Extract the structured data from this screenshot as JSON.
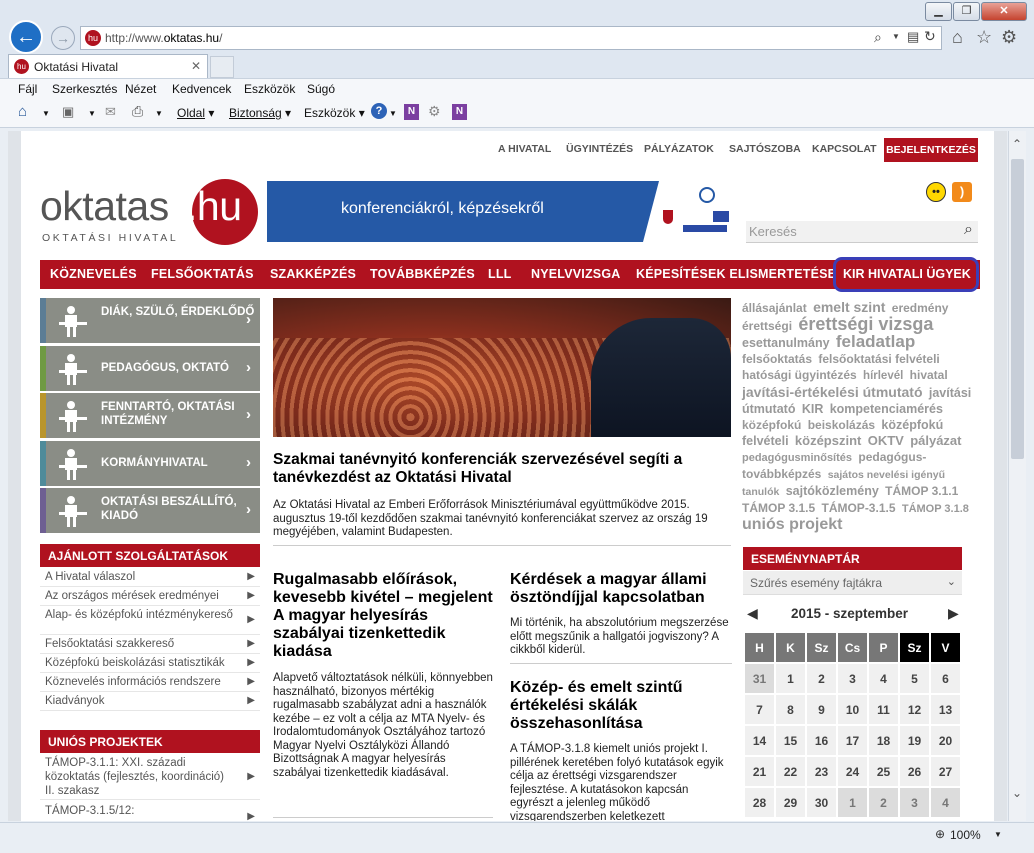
{
  "browser": {
    "url_prefix": "http://www.",
    "url_domain": "oktatas.hu",
    "url_suffix": "/",
    "tab_title": "Oktatási Hivatal",
    "menu": [
      "Fájl",
      "Szerkesztés",
      "Nézet",
      "Kedvencek",
      "Eszközök",
      "Súgó"
    ],
    "commands": {
      "page": "Oldal",
      "safety": "Biztonság",
      "tools": "Eszközök"
    },
    "zoom": "100%",
    "favicon": "hu"
  },
  "site": {
    "topnav": [
      "A HIVATAL",
      "ÜGYINTÉZÉS",
      "PÁLYÁZATOK",
      "SAJTÓSZOBA",
      "KAPCSOLAT"
    ],
    "login": "BEJELENTKEZÉS",
    "logo_text": "oktatas",
    "logo_hu": ".hu",
    "logo_sub": "OKTATÁSI HIVATAL",
    "banner_text": "konferenciákról, képzésekről",
    "search_placeholder": "Keresés",
    "mainnav": [
      "KÖZNEVELÉS",
      "FELSŐOKTATÁS",
      "SZAKKÉPZÉS",
      "TOVÁBBKÉPZÉS",
      "LLL",
      "NYELVVIZSGA",
      "KÉPESÍTÉSEK ELISMERTETÉSE",
      "KIR HIVATALI ÜGYEK"
    ],
    "tiles": [
      {
        "label": "DIÁK, SZÜLŐ, ÉRDEKLŐDŐ",
        "color": "#5c7d95"
      },
      {
        "label": "PEDAGÓGUS, OKTATÓ",
        "color": "#6f9a43"
      },
      {
        "label": "FENNTARTÓ, OKTATÁSI INTÉZMÉNY",
        "color": "#b9952c"
      },
      {
        "label": "KORMÁNYHIVATAL",
        "color": "#4f8b9a"
      },
      {
        "label": "OKTATÁSI BESZÁLLÍTÓ, KIADÓ",
        "color": "#6e5f92"
      }
    ],
    "recommended_title": "AJÁNLOTT SZOLGÁLTATÁSOK",
    "recommended": [
      "A Hivatal válaszol",
      "Az országos mérések eredményei",
      "Alap- és középfokú intézménykereső",
      "Felsőoktatási szakkereső",
      "Középfokú beiskolázási statisztikák",
      "Köznevelés információs rendszere",
      "Kiadványok"
    ],
    "eu_title": "UNIÓS PROJEKTEK",
    "eu_items": [
      "TÁMOP-3.1.1: XXI. századi közoktatás (fejlesztés, koordináció) II. szakasz",
      "TÁMOP-3.1.5/12:"
    ],
    "hero_title": "Szakmai tanévnyitó konferenciák szervezésével segíti a tanévkezdést az Oktatási Hivatal",
    "hero_text": "Az Oktatási Hivatal az Emberi Erőforrások Minisztériumával együttműködve 2015. augusztus 19-től kezdődően szakmai tanévnyitó konferenciákat szervez az ország 19 megyéjében, valamint Budapesten.",
    "articles": [
      {
        "title": "Rugalmasabb előírások, kevesebb kivétel – megjelent A magyar helyesírás szabályai tizenkettedik kiadása",
        "text": "Alapvető változtatások nélküli, könnyebben használható, bizonyos mértékig rugalmasabb szabályzat adni a használók kezébe – ez volt a célja az MTA Nyelv- és Irodalomtudományok Osztályához tartozó Magyar Nyelvi Osztályközi Állandó Bizottságnak A magyar helyesírás szabályai tizenkettedik kiadásával."
      },
      {
        "title": "Kérdések a magyar állami ösztöndíjjal kapcsolatban",
        "text": "Mi történik, ha abszolutórium megszerzése előtt megszűnik a hallgatói jogviszony? A cikkből kiderül."
      },
      {
        "title": "Közép- és emelt szintű értékelési skálák összehasonlítása",
        "text": "A TÁMOP-3.1.8 kiemelt uniós projekt I. pillérének keretében folyó kutatások egyik célja az érettségi vizsgarendszer fejlesztése. A kutatásokon kapcsán egyrészt a jelenleg működő vizsgarendszerben keletkezett"
      }
    ],
    "tags": [
      {
        "t": "állásajánlat",
        "s": 12
      },
      {
        "t": "emelt szint",
        "s": 14
      },
      {
        "t": "eredmény",
        "s": 12
      },
      {
        "t": "érettségi",
        "s": 12
      },
      {
        "t": "érettségi vizsga",
        "s": 18
      },
      {
        "t": "esettanulmány",
        "s": 12.5
      },
      {
        "t": "feladatlap",
        "s": 17
      },
      {
        "t": "felsőoktatás",
        "s": 12
      },
      {
        "t": "felsőoktatási felvételi",
        "s": 12
      },
      {
        "t": "hatósági ügyintézés",
        "s": 12
      },
      {
        "t": "hírlevél",
        "s": 11.5
      },
      {
        "t": "hivatal",
        "s": 12
      },
      {
        "t": "javítási-értékelési útmutató",
        "s": 14
      },
      {
        "t": "javítási útmutató",
        "s": 12.5
      },
      {
        "t": "KIR",
        "s": 12.5
      },
      {
        "t": "kompetenciamérés",
        "s": 12.5
      },
      {
        "t": "középfokú",
        "s": 12
      },
      {
        "t": "beiskolázás",
        "s": 12
      },
      {
        "t": "középfokú felvételi",
        "s": 12.5
      },
      {
        "t": "középszint",
        "s": 13
      },
      {
        "t": "OKTV",
        "s": 13
      },
      {
        "t": "pályázat",
        "s": 13
      },
      {
        "t": "pedagógusminősítés",
        "s": 11
      },
      {
        "t": "pedagógus-továbbképzés",
        "s": 12
      },
      {
        "t": "sajátos nevelési igényű tanulók",
        "s": 10.5
      },
      {
        "t": "sajtóközlemény",
        "s": 12.5
      },
      {
        "t": "TÁMOP 3.1.1",
        "s": 12
      },
      {
        "t": "TÁMOP 3.1.5",
        "s": 12
      },
      {
        "t": "TÁMOP-3.1.5",
        "s": 12
      },
      {
        "t": "TÁMOP 3.1.8",
        "s": 11
      },
      {
        "t": "uniós projekt",
        "s": 16
      }
    ],
    "calendar": {
      "title": "ESEMÉNYNAPTÁR",
      "filter": "Szűrés esemény fajtákra",
      "month": "2015 - szeptember",
      "days": [
        "H",
        "K",
        "Sz",
        "Cs",
        "P",
        "Sz",
        "V"
      ],
      "weeks": [
        [
          "31",
          "1",
          "2",
          "3",
          "4",
          "5",
          "6"
        ],
        [
          "7",
          "8",
          "9",
          "10",
          "11",
          "12",
          "13"
        ],
        [
          "14",
          "15",
          "16",
          "17",
          "18",
          "19",
          "20"
        ],
        [
          "21",
          "22",
          "23",
          "24",
          "25",
          "26",
          "27"
        ],
        [
          "28",
          "29",
          "30",
          "1",
          "2",
          "3",
          "4"
        ]
      ]
    },
    "colors": {
      "brand_red": "#b0121f",
      "highlight": "#3a3fb8"
    }
  }
}
